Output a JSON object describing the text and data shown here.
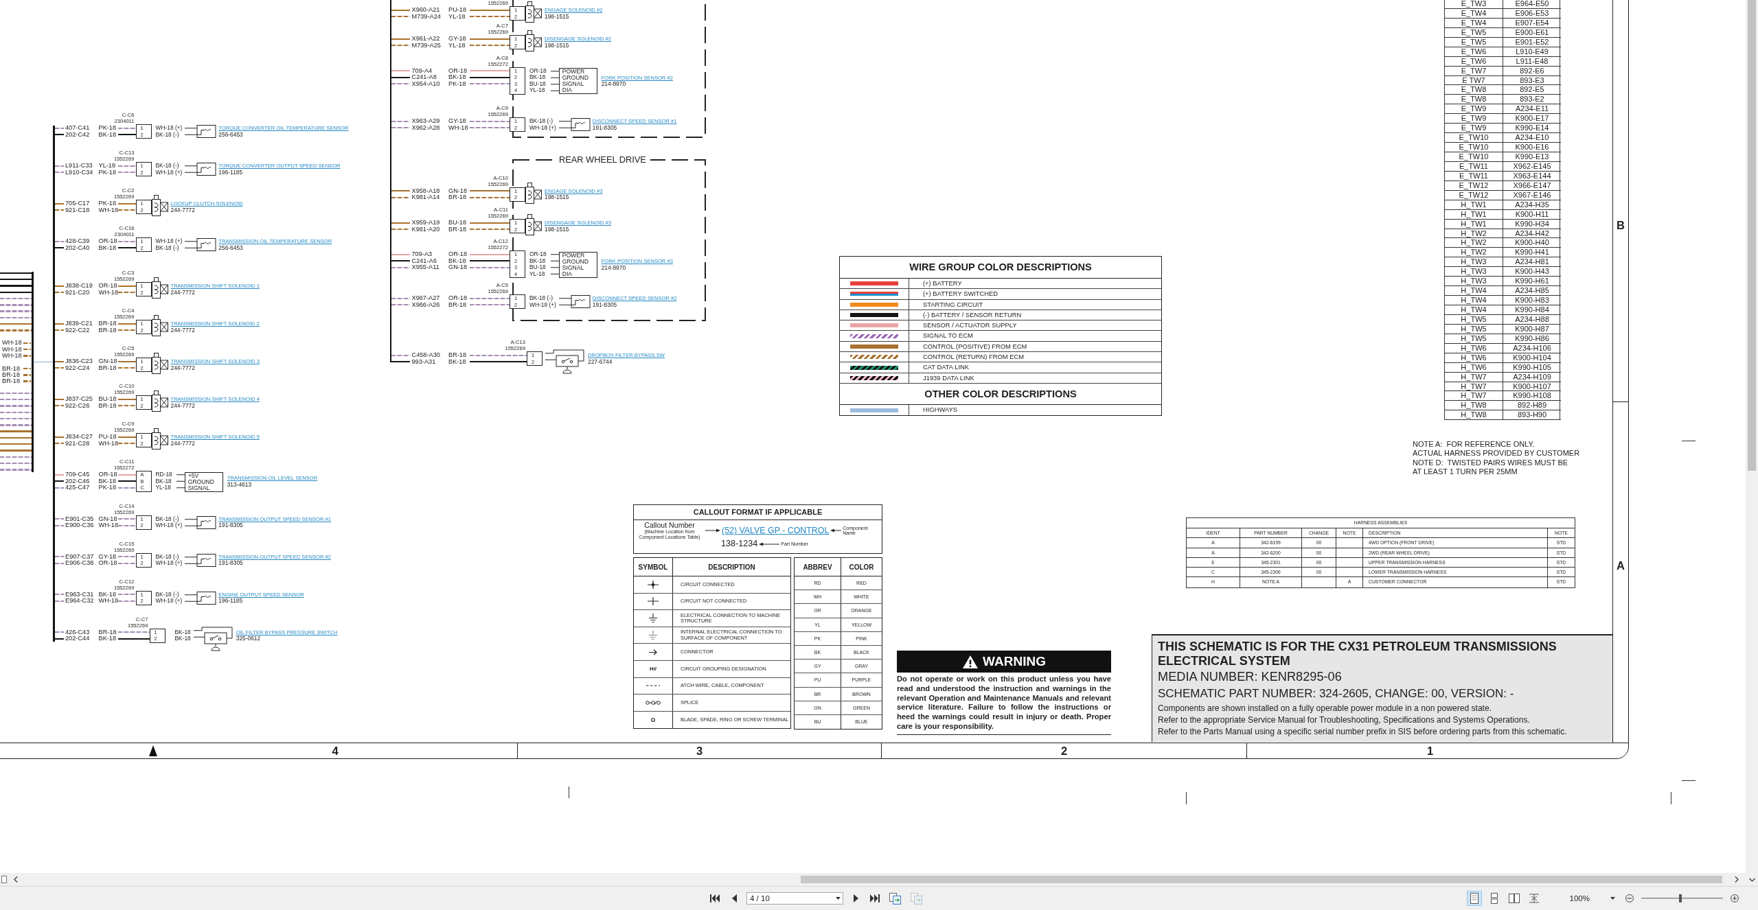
{
  "sheet": {
    "bundle": {
      "labels": [
        {
          "text": "WH-18",
          "kind": "control_return"
        },
        {
          "text": "WH-18",
          "kind": "control_return"
        },
        {
          "text": "WH-18",
          "kind": "control_return"
        },
        {
          "text": "BR-18",
          "kind": "control_return"
        },
        {
          "text": "BR-18",
          "kind": "control_return"
        },
        {
          "text": "BR-18",
          "kind": "control_return"
        }
      ]
    },
    "left_column": {
      "devices": [
        {
          "kind": "sensor",
          "connector": "C-C6",
          "connector_part": "2304011",
          "pins": [
            {
              "pin": "1",
              "circuit": "407-C41",
              "wire": "PK-18",
              "kind": "signal",
              "lead": "WH-18 (+)"
            },
            {
              "pin": "2",
              "circuit": "202-C42",
              "wire": "BK-18",
              "kind": "return",
              "lead": "BK-18 (-)"
            }
          ],
          "name": "TORQUE CONVERTER OIL TEMPERATURE SENSOR",
          "part_number": "256-6453"
        },
        {
          "kind": "sensor",
          "connector": "C-C13",
          "connector_part": "1552269",
          "pins": [
            {
              "pin": "1",
              "circuit": "L911-C33",
              "wire": "YL-18",
              "kind": "signal",
              "lead": "BK-18 (-)"
            },
            {
              "pin": "2",
              "circuit": "L910-C34",
              "wire": "PK-18",
              "kind": "signal",
              "lead": "WH-18 (+)"
            }
          ],
          "name": "TORQUE CONVERTER OUTPUT SPEED SENSOR",
          "part_number": "196-1185"
        },
        {
          "kind": "solenoid",
          "connector": "C-C2",
          "connector_part": "1552269",
          "pins": [
            {
              "pin": "1",
              "circuit": "705-C17",
              "wire": "PK-18",
              "kind": "control_positive"
            },
            {
              "pin": "2",
              "circuit": "921-C18",
              "wire": "WH-18",
              "kind": "control_return"
            }
          ],
          "name": "LOCKUP CLUTCH SOLENOID",
          "part_number": "244-7772"
        },
        {
          "kind": "sensor",
          "connector": "C-C16",
          "connector_part": "2304011",
          "pins": [
            {
              "pin": "1",
              "circuit": "428-C39",
              "wire": "OR-18",
              "kind": "signal",
              "lead": "WH-18 (+)"
            },
            {
              "pin": "2",
              "circuit": "202-C40",
              "wire": "BK-18",
              "kind": "return",
              "lead": "BK-18 (-)"
            }
          ],
          "name": "TRANSMISSION OIL TEMPERATURE SENSOR",
          "part_number": "256-6453"
        },
        {
          "kind": "solenoid",
          "connector": "C-C3",
          "connector_part": "1552269",
          "pins": [
            {
              "pin": "1",
              "circuit": "J838-C19",
              "wire": "OR-18",
              "kind": "control_positive"
            },
            {
              "pin": "2",
              "circuit": "921-C20",
              "wire": "WH-18",
              "kind": "control_return"
            }
          ],
          "name": "TRANSMISSION SHIFT SOLENOID 1",
          "part_number": "244-7772"
        },
        {
          "kind": "solenoid",
          "connector": "C-C4",
          "connector_part": "1552269",
          "pins": [
            {
              "pin": "1",
              "circuit": "J839-C21",
              "wire": "BR-18",
              "kind": "control_positive"
            },
            {
              "pin": "2",
              "circuit": "922-C22",
              "wire": "BR-18",
              "kind": "control_return"
            }
          ],
          "name": "TRANSMISSION SHIFT SOLENOID 2",
          "part_number": "244-7772"
        },
        {
          "kind": "solenoid",
          "connector": "C-C5",
          "connector_part": "1552269",
          "pins": [
            {
              "pin": "1",
              "circuit": "J836-C23",
              "wire": "GN-18",
              "kind": "control_positive"
            },
            {
              "pin": "2",
              "circuit": "922-C24",
              "wire": "BR-18",
              "kind": "control_return"
            }
          ],
          "name": "TRANSMISSION SHIFT SOLENOID 3",
          "part_number": "244-7772"
        },
        {
          "kind": "solenoid",
          "connector": "C-C10",
          "connector_part": "1552269",
          "pins": [
            {
              "pin": "1",
              "circuit": "J837-C25",
              "wire": "BU-18",
              "kind": "control_positive"
            },
            {
              "pin": "2",
              "circuit": "922-C26",
              "wire": "BR-18",
              "kind": "control_return"
            }
          ],
          "name": "TRANSMISSION SHIFT SOLENOID 4",
          "part_number": "244-7772"
        },
        {
          "kind": "solenoid",
          "connector": "C-C9",
          "connector_part": "1552269",
          "pins": [
            {
              "pin": "1",
              "circuit": "J834-C27",
              "wire": "PU-18",
              "kind": "control_positive"
            },
            {
              "pin": "2",
              "circuit": "921-C28",
              "wire": "WH-18",
              "kind": "control_return"
            }
          ],
          "name": "TRANSMISSION SHIFT SOLENOID 5",
          "part_number": "244-7772"
        },
        {
          "kind": "module",
          "connector": "C-C11",
          "connector_part": "1552272",
          "pins": [
            {
              "pin": "A",
              "circuit": "709-C45",
              "wire": "OR-18",
              "kind": "supply",
              "lead": "RD-18"
            },
            {
              "pin": "B",
              "circuit": "202-C46",
              "wire": "BK-18",
              "kind": "return",
              "lead": "BK-18"
            },
            {
              "pin": "C",
              "circuit": "425-C47",
              "wire": "PK-18",
              "kind": "signal",
              "lead": "YL-18"
            }
          ],
          "terminals": [
            "+5V",
            "GROUND",
            "SIGNAL"
          ],
          "name": "TRANSMISSION OIL LEVEL SENSOR",
          "part_number": "313-4613"
        },
        {
          "kind": "sensor",
          "connector": "C-C14",
          "connector_part": "1552269",
          "pins": [
            {
              "pin": "1",
              "circuit": "E901-C35",
              "wire": "GN-18",
              "kind": "signal",
              "lead": "BK-18 (-)"
            },
            {
              "pin": "2",
              "circuit": "E900-C36",
              "wire": "WH-18",
              "kind": "signal",
              "lead": "WH-18 (+)"
            }
          ],
          "name": "TRANSMISSION OUTPUT SPEED SENSOR #1",
          "part_number": "191-8305"
        },
        {
          "kind": "sensor",
          "connector": "C-C15",
          "connector_part": "1552269",
          "pins": [
            {
              "pin": "1",
              "circuit": "E907-C37",
              "wire": "GY-18",
              "kind": "signal",
              "lead": "BK-18 (-)"
            },
            {
              "pin": "2",
              "circuit": "E906-C38",
              "wire": "OR-18",
              "kind": "signal",
              "lead": "WH-18 (+)"
            }
          ],
          "name": "TRANSMISSION OUTPUT SPEED SENSOR #2",
          "part_number": "191-8305"
        },
        {
          "kind": "sensor",
          "connector": "C-C12",
          "connector_part": "1552269",
          "pins": [
            {
              "pin": "1",
              "circuit": "E963-C31",
              "wire": "BK-18",
              "kind": "signal",
              "lead": "BK-18 (-)"
            },
            {
              "pin": "2",
              "circuit": "E964-C32",
              "wire": "WH-18",
              "kind": "signal",
              "lead": "WH-18 (+)"
            }
          ],
          "name": "ENGINE OUTPUT SPEED SENSOR",
          "part_number": "196-1185"
        },
        {
          "kind": "switch",
          "connector": "C-C7",
          "connector_part": "1552269",
          "pins": [
            {
              "pin": "1",
              "circuit": "426-C43",
              "wire": "BR-18",
              "kind": "signal",
              "lead": "BK-18"
            },
            {
              "pin": "2",
              "circuit": "202-C44",
              "wire": "BK-18",
              "kind": "return",
              "lead": "BK-18"
            }
          ],
          "name": "OIL FILTER BYPASS PRESSURE SWITCH",
          "part_number": "325-0612"
        }
      ]
    },
    "middle_column": {
      "groups": [
        {
          "devices": [
            {
              "kind": "solenoid",
              "connector_part": "1552269",
              "pins": [
                {
                  "pin": "1",
                  "circuit": "X960-A21",
                  "wire": "PU-18",
                  "kind": "control_positive"
                },
                {
                  "pin": "2",
                  "circuit": "M739-A24",
                  "wire": "YL-18",
                  "kind": "control_return"
                }
              ],
              "name": "ENGAGE SOLENOID #2",
              "part_number": "198-1515"
            },
            {
              "kind": "solenoid",
              "connector": "A-C7",
              "connector_part": "1552269",
              "pins": [
                {
                  "pin": "1",
                  "circuit": "X961-A22",
                  "wire": "GY-18",
                  "kind": "control_positive"
                },
                {
                  "pin": "2",
                  "circuit": "M739-A25",
                  "wire": "YL-18",
                  "kind": "control_return"
                }
              ],
              "name": "DISENGAGE SOLENOID #2",
              "part_number": "198-1515"
            },
            {
              "kind": "module",
              "connector": "A-C8",
              "connector_part": "1552272",
              "pins": [
                {
                  "pin": "1",
                  "circuit": "709-A4",
                  "wire": "OR-18",
                  "kind": "supply",
                  "lead": "OR-18"
                },
                {
                  "pin": "2",
                  "circuit": "C241-A8",
                  "wire": "BK-18",
                  "kind": "return",
                  "lead": "BK-18"
                },
                {
                  "pin": "3",
                  "circuit": "X954-A10",
                  "wire": "PK-18",
                  "kind": "signal",
                  "lead": "BU-18"
                },
                {
                  "pin": "4",
                  "lead": "YL-18"
                }
              ],
              "terminals": [
                "POWER",
                "GROUND",
                "SIGNAL",
                "DIA"
              ],
              "name": "FORK POSITION SENSOR #2",
              "part_number": "214-8970"
            },
            {
              "kind": "sensor",
              "connector": "A-C9",
              "connector_part": "1552269",
              "pins": [
                {
                  "pin": "1",
                  "circuit": "X963-A29",
                  "wire": "GY-18",
                  "kind": "signal",
                  "lead": "BK-18 (-)"
                },
                {
                  "pin": "2",
                  "circuit": "X962-A28",
                  "wire": "WH-18",
                  "kind": "signal",
                  "lead": "WH-18 (+)"
                }
              ],
              "name": "DISCONNECT SPEED SENSOR #1",
              "part_number": "191-8305"
            }
          ]
        },
        {
          "title": "REAR WHEEL DRIVE",
          "devices": [
            {
              "kind": "solenoid",
              "connector": "A-C10",
              "connector_part": "1552269",
              "pins": [
                {
                  "pin": "1",
                  "circuit": "X958-A18",
                  "wire": "GN-18",
                  "kind": "control_positive"
                },
                {
                  "pin": "2",
                  "circuit": "K981-A14",
                  "wire": "BR-18",
                  "kind": "control_return"
                }
              ],
              "name": "ENGAGE SOLENOID #3",
              "part_number": "198-1515"
            },
            {
              "kind": "solenoid",
              "connector": "A-C11",
              "connector_part": "1552269",
              "pins": [
                {
                  "pin": "1",
                  "circuit": "X959-A19",
                  "wire": "BU-18",
                  "kind": "control_positive"
                },
                {
                  "pin": "2",
                  "circuit": "K981-A20",
                  "wire": "BR-18",
                  "kind": "control_return"
                }
              ],
              "name": "DISENGAGE SOLENOID #3",
              "part_number": "198-1515"
            },
            {
              "kind": "module",
              "connector": "A-C12",
              "connector_part": "1552272",
              "pins": [
                {
                  "pin": "1",
                  "circuit": "709-A3",
                  "wire": "OR-18",
                  "kind": "supply",
                  "lead": "OR-18"
                },
                {
                  "pin": "2",
                  "circuit": "C241-A6",
                  "wire": "BK-18",
                  "kind": "return",
                  "lead": "BK-18"
                },
                {
                  "pin": "3",
                  "circuit": "X955-A11",
                  "wire": "GN-18",
                  "kind": "signal",
                  "lead": "BU-18"
                },
                {
                  "pin": "4",
                  "lead": "YL-18"
                }
              ],
              "terminals": [
                "POWER",
                "GROUND",
                "SIGNAL",
                "DIA"
              ],
              "name": "FORK POSITION SENSOR #3",
              "part_number": "214-8970"
            },
            {
              "kind": "sensor",
              "connector": "A-C5",
              "connector_part": "1552269",
              "pins": [
                {
                  "pin": "1",
                  "circuit": "X967-A27",
                  "wire": "OR-18",
                  "kind": "signal",
                  "lead": "BK-18 (-)"
                },
                {
                  "pin": "2",
                  "circuit": "X966-A26",
                  "wire": "BR-18",
                  "kind": "signal",
                  "lead": "WH-18 (+)"
                }
              ],
              "name": "DISCONNECT SPEED SENSOR #2",
              "part_number": "191-8305"
            }
          ]
        }
      ],
      "devices": [
        {
          "kind": "switch",
          "connector": "A-C13",
          "connector_part": "1552269",
          "pins": [
            {
              "pin": "1",
              "circuit": "C458-A30",
              "wire": "BR-18",
              "kind": "signal"
            },
            {
              "pin": "2",
              "circuit": "993-A31",
              "wire": "BK-18",
              "kind": "return"
            }
          ],
          "name": "DROPBOX FILTER BYPASS SW",
          "part_number": "227-6744"
        }
      ]
    },
    "wire_legend": {
      "title": "WIRE GROUP COLOR DESCRIPTIONS",
      "items": [
        {
          "kind": "battery",
          "label": "(+) BATTERY"
        },
        {
          "kind": "battery_switched",
          "label": "(+) BATTERY SWITCHED"
        },
        {
          "kind": "starting",
          "label": "STARTING CIRCUIT"
        },
        {
          "kind": "return",
          "label": "(-) BATTERY / SENSOR RETURN"
        },
        {
          "kind": "supply",
          "label": "SENSOR / ACTUATOR SUPPLY"
        },
        {
          "kind": "signal",
          "label": "SIGNAL TO ECM"
        },
        {
          "kind": "control_positive",
          "label": "CONTROL (POSITIVE) FROM ECM"
        },
        {
          "kind": "control_return",
          "label": "CONTROL (RETURN) FROM ECM"
        },
        {
          "kind": "cat_data_link",
          "label": "CAT DATA LINK"
        },
        {
          "kind": "j1939",
          "label": "J1939 DATA LINK"
        }
      ],
      "other_title": "OTHER COLOR DESCRIPTIONS",
      "other_items": [
        {
          "kind": "highway",
          "label": "HIGHWAYS"
        }
      ]
    },
    "callout_format": {
      "title": "CALLOUT FORMAT IF APPLICABLE",
      "callout_label": "Callout Number",
      "callout_note": "(Machine Location from Component Locations Table)",
      "example_name": "(52) VALVE GP - CONTROL",
      "name_label": "Component Name",
      "example_part": "138-1234",
      "part_label": "Part Number"
    },
    "symbols": {
      "columns": [
        "SYMBOL",
        "DESCRIPTION"
      ],
      "rows": [
        {
          "kind": "connected",
          "description": "CIRCUIT CONNECTED"
        },
        {
          "kind": "not_connected",
          "description": "CIRCUIT NOT CONNECTED"
        },
        {
          "kind": "machine_ground",
          "description": "ELECTRICAL CONNECTION TO MACHINE STRUCTURE"
        },
        {
          "kind": "component_ground",
          "description": "INTERNAL ELECTRICAL CONNECTION TO SURFACE OF COMPONENT"
        },
        {
          "kind": "connector",
          "description": "CONNECTOR"
        },
        {
          "kind": "text",
          "symbol": "H#",
          "description": "CIRCUIT GROUPING DESIGNATION"
        },
        {
          "kind": "dashed",
          "description": "ATCH WIRE, CABLE, COMPONENT"
        },
        {
          "kind": "splice",
          "description": "SPLICE"
        },
        {
          "kind": "terminal",
          "description": "BLADE, SPADE, RING OR SCREW TERMINAL"
        }
      ]
    },
    "abbreviations": {
      "columns": [
        "ABBREV",
        "COLOR"
      ],
      "rows": [
        [
          "RD",
          "RED"
        ],
        [
          "WH",
          "WHITE"
        ],
        [
          "OR",
          "ORANGE"
        ],
        [
          "YL",
          "YELLOW"
        ],
        [
          "PK",
          "PINK"
        ],
        [
          "BK",
          "BLACK"
        ],
        [
          "GY",
          "GRAY"
        ],
        [
          "PU",
          "PURPLE"
        ],
        [
          "BR",
          "BROWN"
        ],
        [
          "GN",
          "GREEN"
        ],
        [
          "BU",
          "BLUE"
        ]
      ]
    },
    "warning": {
      "title": "WARNING",
      "text": "Do not operate or work on this product unless you have read and understood the instruction and warnings in the relevant Operation and Maintenance Manuals and relevant service literature. Failure to follow the instructions or heed the warnings could result in injury or death. Proper care is your responsibility."
    },
    "twisted_pairs": {
      "rows": [
        [
          "E_TW3",
          "E964-E50"
        ],
        [
          "E_TW4",
          "E906-E53"
        ],
        [
          "E_TW4",
          "E907-E54"
        ],
        [
          "E_TW5",
          "E900-E61"
        ],
        [
          "E_TW5",
          "E901-E52"
        ],
        [
          "E_TW6",
          "L910-E49"
        ],
        [
          "E_TW6",
          "L911-E48"
        ],
        [
          "E_TW7",
          "892-E6"
        ],
        [
          "E TW7",
          "893-E3"
        ],
        [
          "E_TW8",
          "892-E5"
        ],
        [
          "E_TW8",
          "893-E2"
        ],
        [
          "E_TW9",
          "A234-E11"
        ],
        [
          "E_TW9",
          "K900-E17"
        ],
        [
          "E_TW9",
          "K990-E14"
        ],
        [
          "E_TW10",
          "A234-E10"
        ],
        [
          "E_TW10",
          "K900-E16"
        ],
        [
          "E_TW10",
          "K990-E13"
        ],
        [
          "E_TW11",
          "X962-E145"
        ],
        [
          "E_TW11",
          "X963-E144"
        ],
        [
          "E_TW12",
          "X966-E147"
        ],
        [
          "E_TW12",
          "X967-E146"
        ],
        [
          "H_TW1",
          "A234-H35"
        ],
        [
          "H_TW1",
          "K900-H11"
        ],
        [
          "H_TW1",
          "K990-H34"
        ],
        [
          "H_TW2",
          "A234-H42"
        ],
        [
          "H_TW2",
          "K900-H40"
        ],
        [
          "H_TW2",
          "K990-H41"
        ],
        [
          "H_TW3",
          "A234-H81"
        ],
        [
          "H_TW3",
          "K900-H43"
        ],
        [
          "H_TW3",
          "K990-H61"
        ],
        [
          "H_TW4",
          "A234-H85"
        ],
        [
          "H_TW4",
          "K900-H83"
        ],
        [
          "H_TW4",
          "K990-H84"
        ],
        [
          "H_TW5",
          "A234-H88"
        ],
        [
          "H_TW5",
          "K900-H87"
        ],
        [
          "H_TW5",
          "K990-H86"
        ],
        [
          "H_TW6",
          "A234-H106"
        ],
        [
          "H_TW6",
          "K900-H104"
        ],
        [
          "H_TW6",
          "K990-H105"
        ],
        [
          "H_TW7",
          "A234-H109"
        ],
        [
          "H_TW7",
          "K900-H107"
        ],
        [
          "H_TW7",
          "K990-H108"
        ],
        [
          "H_TW8",
          "892-H89"
        ],
        [
          "H_TW8",
          "893-H90"
        ]
      ]
    },
    "notes": [
      "NOTE A:  FOR REFERENCE ONLY.",
      "ACTUAL HARNESS PROVIDED BY CUSTOMER",
      "NOTE D:  TWISTED PAIRS WIRES MUST BE",
      "AT LEAST 1 TURN PER 25MM"
    ],
    "harness_assemblies": {
      "title": "HARNESS ASSEMBLIES",
      "columns": [
        "IDENT",
        "PART NUMBER",
        "CHANGE",
        "NOTE",
        "DESCRIPTION",
        "NOTE"
      ],
      "rows": [
        {
          "ident": "A",
          "part_number": "342-6199",
          "change": "00",
          "description": "4WD OPTION (FRONT DRIVE)",
          "note_2": "STD"
        },
        {
          "ident": "A",
          "part_number": "342-6200",
          "change": "00",
          "description": "2WD (REAR WHEEL DRIVE)",
          "note_2": "STD"
        },
        {
          "ident": "E",
          "part_number": "345-2301",
          "change": "00",
          "description": "UPPER TRANSMISSION HARNESS",
          "note_2": "STD"
        },
        {
          "ident": "C",
          "part_number": "345-2306",
          "change": "00",
          "description": "LOWER TRANSMISSION HARNESS",
          "note_2": "STD"
        },
        {
          "ident": "H",
          "part_number": "NOTE A",
          "note": "A",
          "description": "CUSTOMER CONNECTOR",
          "note_2": "STD"
        }
      ]
    },
    "title_block": {
      "heading": "THIS SCHEMATIC IS FOR THE CX31 PETROLEUM TRANSMISSIONS ELECTRICAL SYSTEM",
      "media_number": "MEDIA NUMBER: KENR8295-06",
      "part_number": "SCHEMATIC PART NUMBER: 324-2605, CHANGE: 00, VERSION: -",
      "notes": [
        "Components are shown installed on a fully operable power module in a non powered state.",
        "Refer to the appropriate Service Manual for Troubleshooting, Specifications and Systems Operations.",
        "Refer to the Parts Manual using a specific serial number prefix in SIS before ordering parts from this schematic."
      ]
    },
    "zones": {
      "columns": [
        "4",
        "3",
        "2",
        "1"
      ],
      "rows": [
        "B",
        "A"
      ]
    }
  },
  "viewer": {
    "page_field": {
      "value": "4 / 10"
    },
    "history": [
      {
        "disabled": false
      },
      {
        "disabled": true
      }
    ],
    "view_modes": [
      {
        "kind": "single",
        "selected": true
      },
      {
        "kind": "continuous",
        "selected": false
      },
      {
        "kind": "facing",
        "selected": false
      },
      {
        "kind": "book",
        "selected": false
      }
    ],
    "zoom_field": {
      "value": "100%"
    },
    "zoom_slider": {
      "level": 0.48
    }
  }
}
